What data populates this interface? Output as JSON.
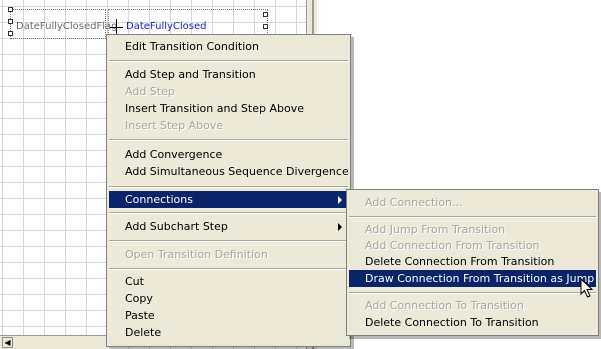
{
  "canvas": {
    "step_left_label": "DateFullyClosedFlag",
    "step_right_label": "DateFullyClosed"
  },
  "main_menu": {
    "edit_transition_condition": "Edit Transition Condition",
    "add_step_and_transition": "Add Step and Transition",
    "add_step": "Add Step",
    "insert_transition_and_step_above": "Insert Transition and Step Above",
    "insert_step_above": "Insert Step Above",
    "add_convergence": "Add Convergence",
    "add_simultaneous_sequence_divergence": "Add Simultaneous Sequence Divergence",
    "connections": "Connections",
    "add_subchart_step": "Add Subchart Step",
    "open_transition_definition": "Open Transition Definition",
    "cut": "Cut",
    "copy": "Copy",
    "paste": "Paste",
    "delete": "Delete"
  },
  "sub_menu": {
    "add_connection": "Add Connection...",
    "add_jump_from_transition": "Add Jump From Transition",
    "add_connection_from_transition": "Add Connection From Transition",
    "delete_connection_from_transition": "Delete Connection From Transition",
    "draw_connection_from_transition_as_jump": "Draw Connection From Transition as Jump",
    "add_connection_to_transition": "Add Connection To Transition",
    "delete_connection_to_transition": "Delete Connection To Transition"
  },
  "colors": {
    "menu_background": "#ece9d8",
    "highlight": "#0a246a",
    "disabled_text": "#a9a79f",
    "link_label": "#1a1ac8"
  },
  "icons": [
    "scroll-left-arrow-icon",
    "submenu-arrow-icon",
    "mouse-pointer-icon"
  ]
}
